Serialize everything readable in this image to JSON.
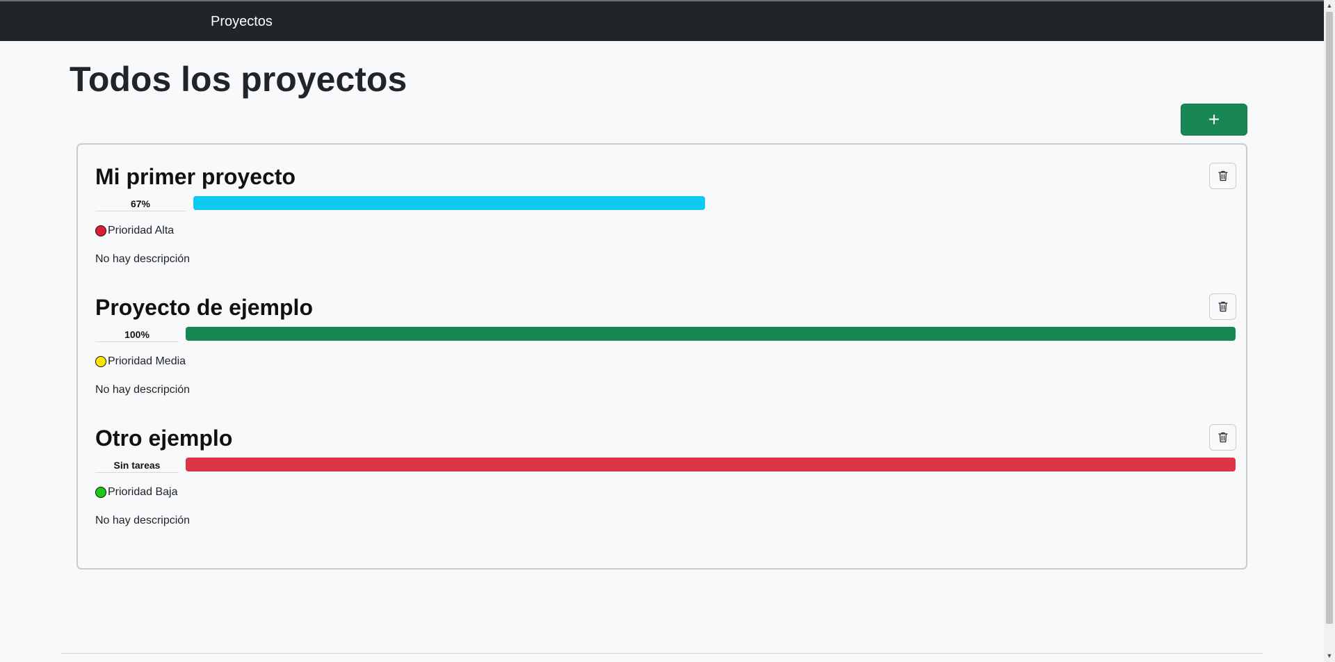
{
  "navbar": {
    "link_label": "Proyectos"
  },
  "page": {
    "title": "Todos los proyectos",
    "add_label": "+"
  },
  "projects": [
    {
      "name": "Mi primer proyecto",
      "progress_label": "67%",
      "progress": 0.67,
      "bar_color": "#0dcaf0",
      "priority_label": "Prioridad Alta",
      "priority_color": "#dc1f32",
      "description": "No hay descripción",
      "delete_icon": "trash-icon"
    },
    {
      "name": "Proyecto de ejemplo",
      "progress_label": "100%",
      "progress": 1.0,
      "bar_color": "#198754",
      "priority_label": "Prioridad Media",
      "priority_color": "#ffe600",
      "description": "No hay descripción",
      "delete_icon": "trash-icon"
    },
    {
      "name": "Otro ejemplo",
      "progress_label": "Sin tareas",
      "progress": 1.0,
      "bar_color": "#dc3545",
      "priority_label": "Prioridad Baja",
      "priority_color": "#19c919",
      "description": "No hay descripción",
      "delete_icon": "trash-icon"
    }
  ],
  "colors": {
    "navbar": "#212529",
    "success": "#198754",
    "page_background": "#f8f9fa"
  }
}
